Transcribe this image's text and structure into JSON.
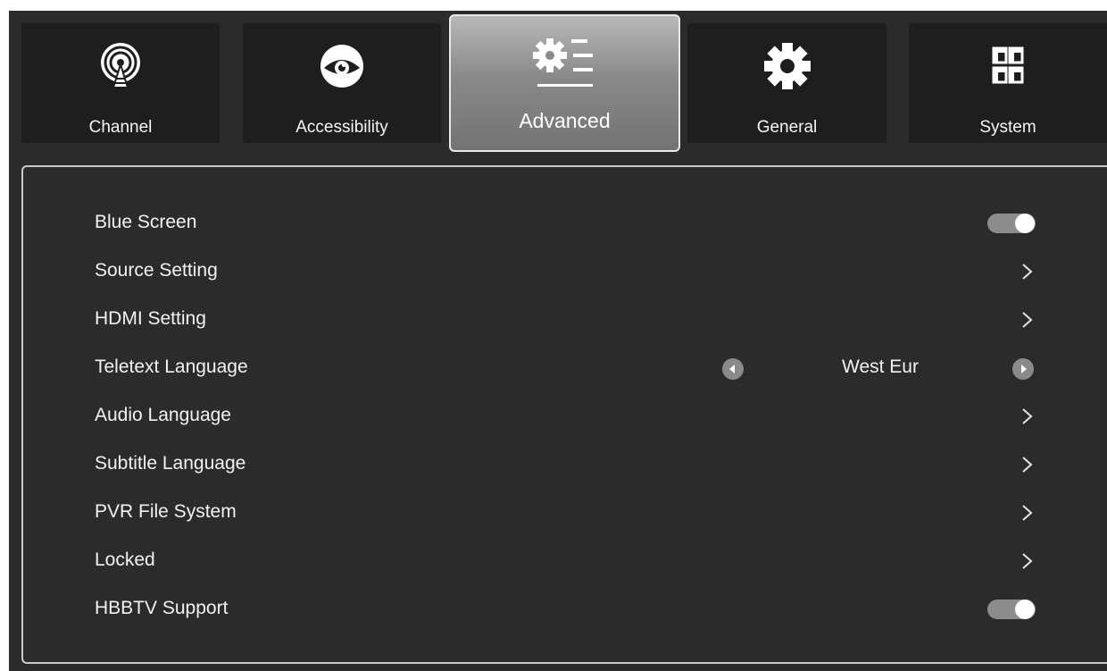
{
  "tabs": [
    {
      "label": "Channel",
      "icon": "antenna-icon",
      "active": false
    },
    {
      "label": "Accessibility",
      "icon": "eye-icon",
      "active": false
    },
    {
      "label": "Advanced",
      "icon": "advanced-settings-icon",
      "active": true
    },
    {
      "label": "General",
      "icon": "gear-icon",
      "active": false
    },
    {
      "label": "System",
      "icon": "grid-windows-icon",
      "active": false
    }
  ],
  "settings": {
    "blue_screen": {
      "label": "Blue Screen",
      "control": "toggle",
      "on": true
    },
    "source_setting": {
      "label": "Source Setting",
      "control": "chevron"
    },
    "hdmi_setting": {
      "label": "HDMI Setting",
      "control": "chevron"
    },
    "teletext_language": {
      "label": "Teletext Language",
      "control": "selector",
      "value": "West Eur"
    },
    "audio_language": {
      "label": "Audio Language",
      "control": "chevron"
    },
    "subtitle_language": {
      "label": "Subtitle Language",
      "control": "chevron"
    },
    "pvr_file_system": {
      "label": "PVR File System",
      "control": "chevron"
    },
    "locked": {
      "label": "Locked",
      "control": "chevron"
    },
    "hbbtv_support": {
      "label": "HBBTV Support",
      "control": "toggle",
      "on": true
    }
  },
  "colors": {
    "background": "#2b2b2b",
    "tab_background": "#1e1e1e",
    "active_tab": "#8a8a8a",
    "text": "#f2f2f2",
    "toggle_track": "#8c8c8c"
  }
}
